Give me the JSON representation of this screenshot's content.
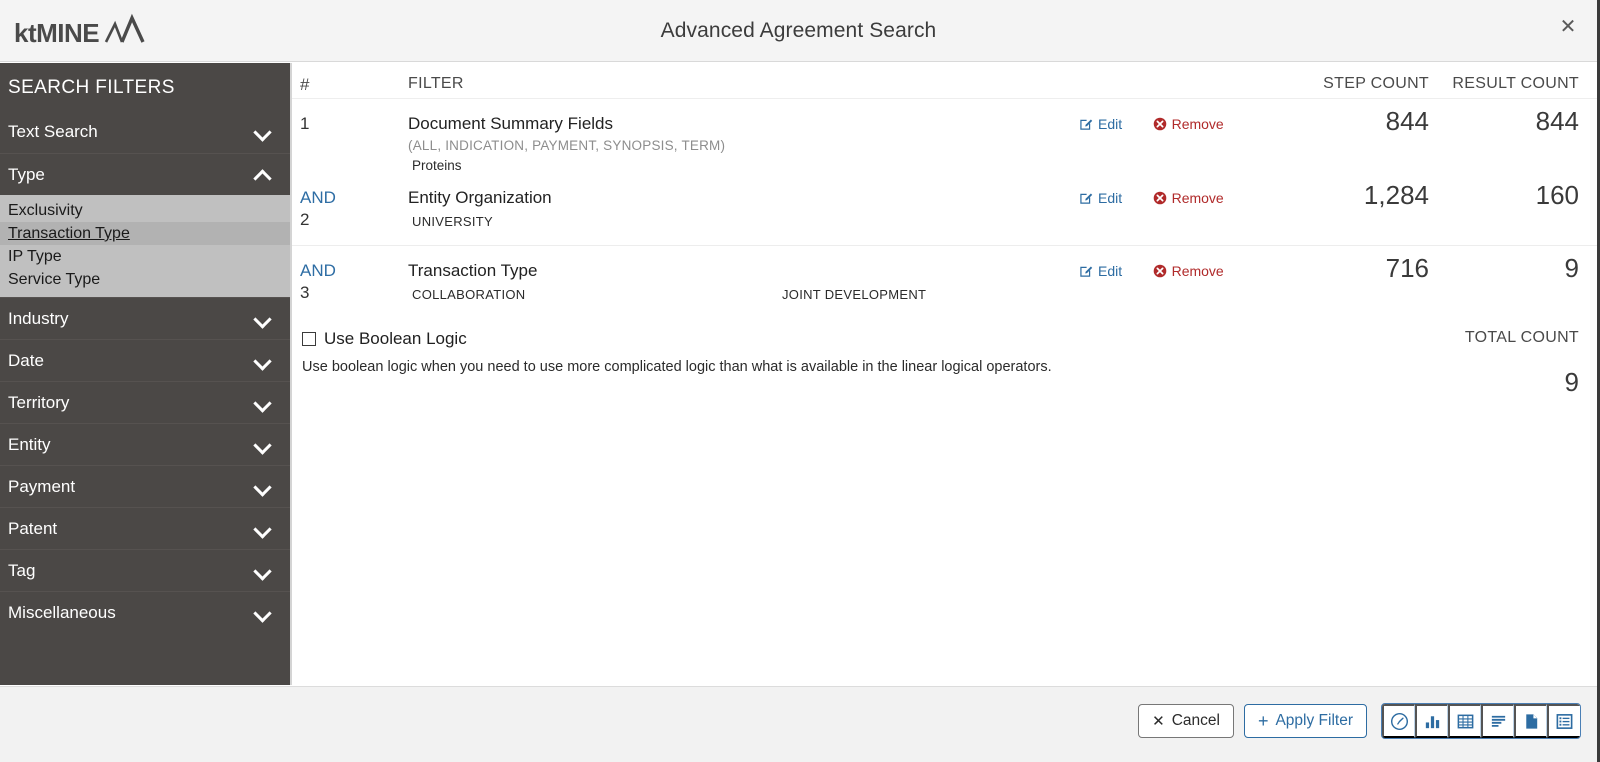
{
  "window": {
    "title": "Advanced Agreement Search",
    "logo_text": "ktMINE",
    "close_icon": "close-icon"
  },
  "sidebar": {
    "title": "SEARCH FILTERS",
    "groups": [
      {
        "label": "Text Search",
        "expanded": false,
        "chevron": "chevron-down-icon"
      },
      {
        "label": "Type",
        "expanded": true,
        "chevron": "chevron-up-icon",
        "items": [
          {
            "label": "Exclusivity",
            "active": false
          },
          {
            "label": "Transaction Type",
            "active": true
          },
          {
            "label": "IP Type",
            "active": false
          },
          {
            "label": "Service Type",
            "active": false
          }
        ]
      },
      {
        "label": "Industry",
        "expanded": false,
        "chevron": "chevron-down-icon"
      },
      {
        "label": "Date",
        "expanded": false,
        "chevron": "chevron-down-icon"
      },
      {
        "label": "Territory",
        "expanded": false,
        "chevron": "chevron-down-icon"
      },
      {
        "label": "Entity",
        "expanded": false,
        "chevron": "chevron-down-icon"
      },
      {
        "label": "Payment",
        "expanded": false,
        "chevron": "chevron-down-icon"
      },
      {
        "label": "Patent",
        "expanded": false,
        "chevron": "chevron-down-icon"
      },
      {
        "label": "Tag",
        "expanded": false,
        "chevron": "chevron-down-icon"
      },
      {
        "label": "Miscellaneous",
        "expanded": false,
        "chevron": "chevron-down-icon"
      }
    ]
  },
  "table": {
    "headers": {
      "num": "#",
      "filter": "FILTER",
      "step_count": "STEP COUNT",
      "result_count": "RESULT COUNT"
    },
    "edit_label": "Edit",
    "remove_label": "Remove",
    "rows": [
      {
        "operator": "",
        "index": "1",
        "name": "Document Summary Fields",
        "fields": "(ALL, INDICATION, PAYMENT, SYNOPSIS, TERM)",
        "values": [
          "Proteins"
        ],
        "step_count": "844",
        "result_count": "844"
      },
      {
        "operator": "AND",
        "index": "2",
        "name": "Entity Organization",
        "fields": "",
        "values": [
          "UNIVERSITY"
        ],
        "step_count": "1,284",
        "result_count": "160"
      },
      {
        "operator": "AND",
        "index": "3",
        "name": "Transaction Type",
        "fields": "",
        "values": [
          "COLLABORATION",
          "JOINT DEVELOPMENT"
        ],
        "step_count": "716",
        "result_count": "9"
      }
    ]
  },
  "boolean": {
    "checkbox_label": "Use Boolean Logic",
    "checked": false,
    "description": "Use boolean logic when you need to use more complicated logic than what is available in the linear logical operators."
  },
  "total": {
    "label": "TOTAL COUNT",
    "value": "9"
  },
  "footer": {
    "cancel_label": "Cancel",
    "cancel_icon": "✕",
    "apply_label": "Apply Filter",
    "apply_icon": "+",
    "view_icons": [
      {
        "name": "dashboard-gauge-icon"
      },
      {
        "name": "bar-chart-icon"
      },
      {
        "name": "table-grid-icon"
      },
      {
        "name": "list-lines-icon"
      },
      {
        "name": "document-page-icon"
      },
      {
        "name": "list-alt-icon"
      }
    ]
  },
  "colors": {
    "sidebar_bg": "#4b4846",
    "sublist_bg": "#c0c0c0",
    "link_blue": "#2d6ca2",
    "remove_red": "#b02a2a",
    "titlebar_bg": "#f4f4f4"
  }
}
